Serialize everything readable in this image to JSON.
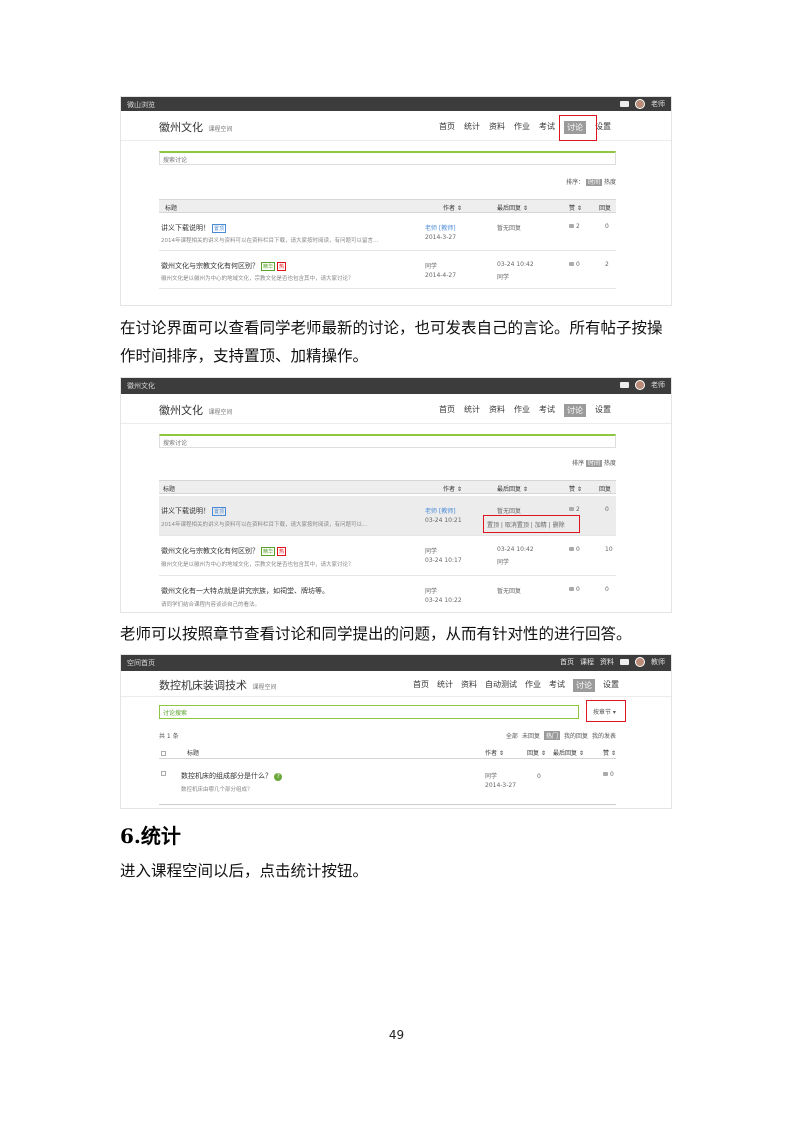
{
  "screenshots": [
    {
      "topbar_brand": "微山浏览",
      "user": "老师",
      "course": "徽州文化",
      "course_sub": "课程空间",
      "menu": [
        "首页",
        "统计",
        "资料",
        "作业",
        "考试",
        "讨论",
        "设置"
      ],
      "search_placeholder": "搜索讨论",
      "sort_label": "排序：",
      "sort_options": [
        "时间",
        "热度"
      ],
      "columns": [
        "标题",
        "作者 ⇕",
        "最后回复 ⇕",
        "赞 ⇕",
        "回复"
      ],
      "rows": [
        {
          "title": "讲义下载说明！",
          "tag": "置顶",
          "desc": "2014年课程相关的讲义与资料可以在资料栏目下载，请大家按时阅读，有问题可以留言…",
          "author": "老师 [教师]",
          "time": "2014-3-27",
          "reply": "暂无回复",
          "likes": "2",
          "replies": "0"
        },
        {
          "title": "徽州文化与宗教文化有何区别？",
          "tag": "精华",
          "tag2": "热",
          "desc": "徽州文化是以徽州为中心的地域文化，宗教文化是否也包含其中，请大家讨论？",
          "author": "同学",
          "time": "2014-4-27",
          "reply": "03-24 10:42",
          "reply_by": "同学",
          "likes": "0",
          "replies": "2"
        }
      ]
    },
    {
      "topbar_brand": "徽州文化",
      "user": "老师",
      "course": "徽州文化",
      "course_sub": "课程空间",
      "menu": [
        "首页",
        "统计",
        "资料",
        "作业",
        "考试",
        "讨论",
        "设置"
      ],
      "search_placeholder": "搜索讨论",
      "sort_label": "排序",
      "sort_options": [
        "时间",
        "热度"
      ],
      "columns": [
        "标题",
        "作者 ⇕",
        "最后回复 ⇕",
        "赞 ⇕",
        "回复"
      ],
      "rows": [
        {
          "title": "讲义下载说明！",
          "tag": "置顶",
          "desc": "2014年课程相关的讲义与资料可以在资料栏目下载，请大家按时阅读，有问题可以…",
          "author": "老师 [教师]",
          "time": "03-24 10:21",
          "reply": "暂无回复",
          "likes": "2",
          "replies": "0",
          "ops": [
            "置顶",
            "取消置顶",
            "加精",
            "删除"
          ]
        },
        {
          "title": "徽州文化与宗教文化有何区别？",
          "tag": "精华",
          "tag2": "热",
          "desc": "徽州文化是以徽州为中心的地域文化，宗教文化是否也包含其中，请大家讨论？",
          "author": "同学",
          "time": "03-24 10:17",
          "reply": "03-24 10:42",
          "reply_by": "同学",
          "likes": "0",
          "replies": "10"
        },
        {
          "title": "徽州文化有一大特点就是讲究宗族，如祠堂、牌坊等。",
          "desc": "请同学们结合课程内容谈谈自己的看法。",
          "author": "同学",
          "time": "03-24 10:22",
          "reply": "暂无回复",
          "likes": "0",
          "replies": "0"
        }
      ]
    },
    {
      "topbar_brand": "空间首页",
      "toplinks": [
        "首页",
        "课程",
        "资料"
      ],
      "user": "教师",
      "course": "数控机床装调技术",
      "course_sub": "课程空间",
      "menu": [
        "首页",
        "统计",
        "资料",
        "自动测试",
        "作业",
        "考试",
        "讨论",
        "设置"
      ],
      "search_placeholder": "讨论搜索",
      "chapter_btn": "按章节 ▾",
      "count_label": "共 1 条",
      "filters": [
        "全部",
        "未回复",
        "热门",
        "我的回复",
        "我的发表"
      ],
      "columns": [
        "标题",
        "作者 ⇕",
        "回复 ⇕",
        "最后回复 ⇕",
        "赞 ⇕"
      ],
      "rows": [
        {
          "title": "数控机床的组成部分是什么？",
          "desc": "数控机床由哪几个部分组成？",
          "author": "同学",
          "time": "2014-3-27",
          "replies": "0",
          "likes": "0"
        }
      ]
    }
  ],
  "paragraphs": [
    "在讨论界面可以查看同学老师最新的讨论，也可发表自己的言论。所有帖子按操作时间排序，支持置顶、加精操作。",
    "老师可以按照章节查看讨论和同学提出的问题，从而有针对性的进行回答。",
    "进入课程空间以后，点击统计按钮。"
  ],
  "heading": "6.统计",
  "page_number": "49"
}
